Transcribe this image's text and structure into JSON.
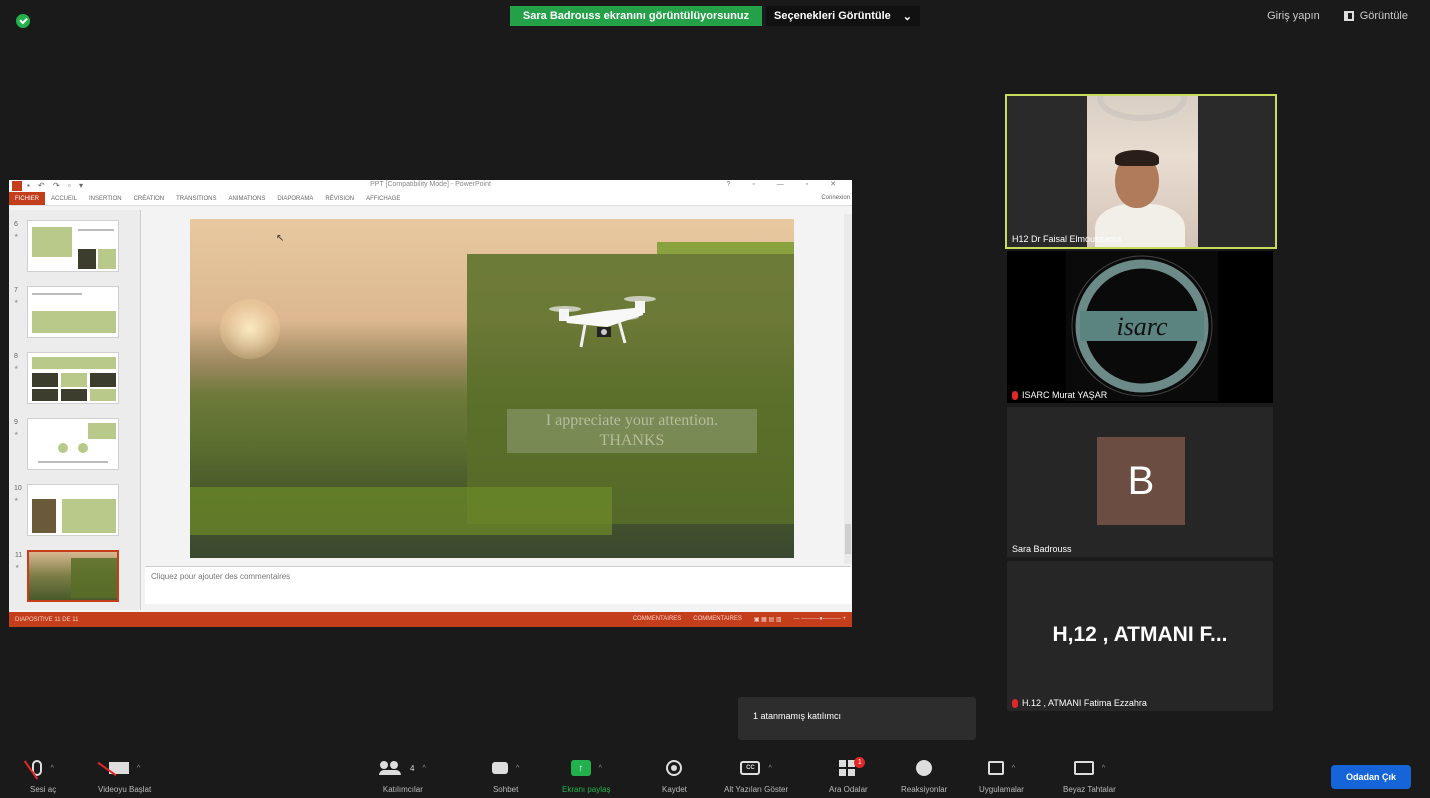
{
  "top_bar": {
    "share_banner": "Sara Badrouss ekranını görüntülüyorsunuz",
    "view_options": "Seçenekleri Görüntüle",
    "view_options_caret": "⌄",
    "sign_in": "Giriş yapın",
    "view": "Görüntüle"
  },
  "ppt": {
    "title": "PPT [Compatibility Mode] - PowerPoint",
    "ribbon_tabs": [
      "FICHIER",
      "ACCUEIL",
      "INSERTION",
      "CRÉATION",
      "TRANSITIONS",
      "ANIMATIONS",
      "DIAPORAMA",
      "RÉVISION",
      "AFFICHAGE"
    ],
    "ribbon_right": "Connexion",
    "thumbs": [
      "6",
      "7",
      "8",
      "9",
      "10",
      "11"
    ],
    "slide_text_line1": "I appreciate your attention.",
    "slide_text_line2": "THANKS",
    "notes_placeholder": "Cliquez pour ajouter des commentaires",
    "status_left": "DIAPOSITIVE 11 DE 11",
    "status_comments": "COMMENTAIRES",
    "status_notes": "COMMENTAIRES"
  },
  "participants": [
    {
      "name": "H12 Dr Faisal Elmoussaoui"
    },
    {
      "name": "ISARC Murat YAŞAR",
      "logo_text": "isarc"
    },
    {
      "name": "Sara Badrouss",
      "initial": "B"
    },
    {
      "name": "H.12 , ATMANI Fatima Ezzahra",
      "display": "H,12 , ATMANI F..."
    }
  ],
  "toast": "1 atanmamış katılımcı",
  "toolbar": {
    "unmute": "Sesi aç",
    "start_video": "Videoyu Başlat",
    "participants": "Katılımcılar",
    "participants_count": "4",
    "chat": "Sohbet",
    "share_screen": "Ekranı paylaş",
    "record": "Kaydet",
    "captions": "Alt Yazıları Göster",
    "breakout": "Ara Odalar",
    "breakout_badge": "1",
    "reactions": "Reaksiyonlar",
    "apps": "Uygulamalar",
    "whiteboard": "Beyaz Tahtalar",
    "leave": "Odadan Çık"
  },
  "colors": {
    "share_green": "#24a148",
    "active_speaker": "#c9dc5a",
    "ppt_accent": "#c43e1c",
    "leave_blue": "#1565d8",
    "mic_red": "#e02828"
  },
  "icons": [
    "shield-check-icon",
    "view-icon",
    "mic-muted-icon",
    "video-off-icon",
    "participants-icon",
    "chat-icon",
    "share-screen-icon",
    "record-icon",
    "captions-icon",
    "breakout-rooms-icon",
    "reactions-icon",
    "apps-icon",
    "whiteboard-icon"
  ]
}
